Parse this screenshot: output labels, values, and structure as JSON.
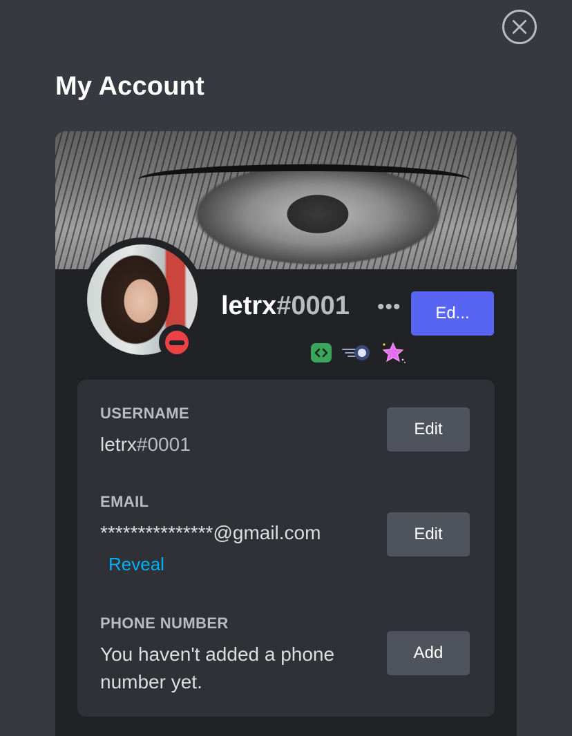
{
  "page": {
    "title": "My Account"
  },
  "profile": {
    "username": "letrx",
    "discriminator": "#0001",
    "more_label": "•••",
    "edit_profile_label": "Ed...",
    "status": "do-not-disturb",
    "badges": [
      "active-developer-badge",
      "hypesquad-bravery-badge",
      "nitro-boost-badge"
    ]
  },
  "fields": {
    "username": {
      "label": "USERNAME",
      "value_name": "letrx",
      "value_disc": "#0001",
      "button_label": "Edit"
    },
    "email": {
      "label": "EMAIL",
      "value": "***************@gmail.com",
      "reveal_label": "Reveal",
      "button_label": "Edit"
    },
    "phone": {
      "label": "PHONE NUMBER",
      "value": "You haven't added a phone number yet.",
      "button_label": "Add"
    }
  },
  "colors": {
    "background": "#36393f",
    "card": "#202225",
    "panel": "#2f3136",
    "accent": "#5865f2",
    "link": "#00aff4",
    "dnd": "#ed4245"
  }
}
